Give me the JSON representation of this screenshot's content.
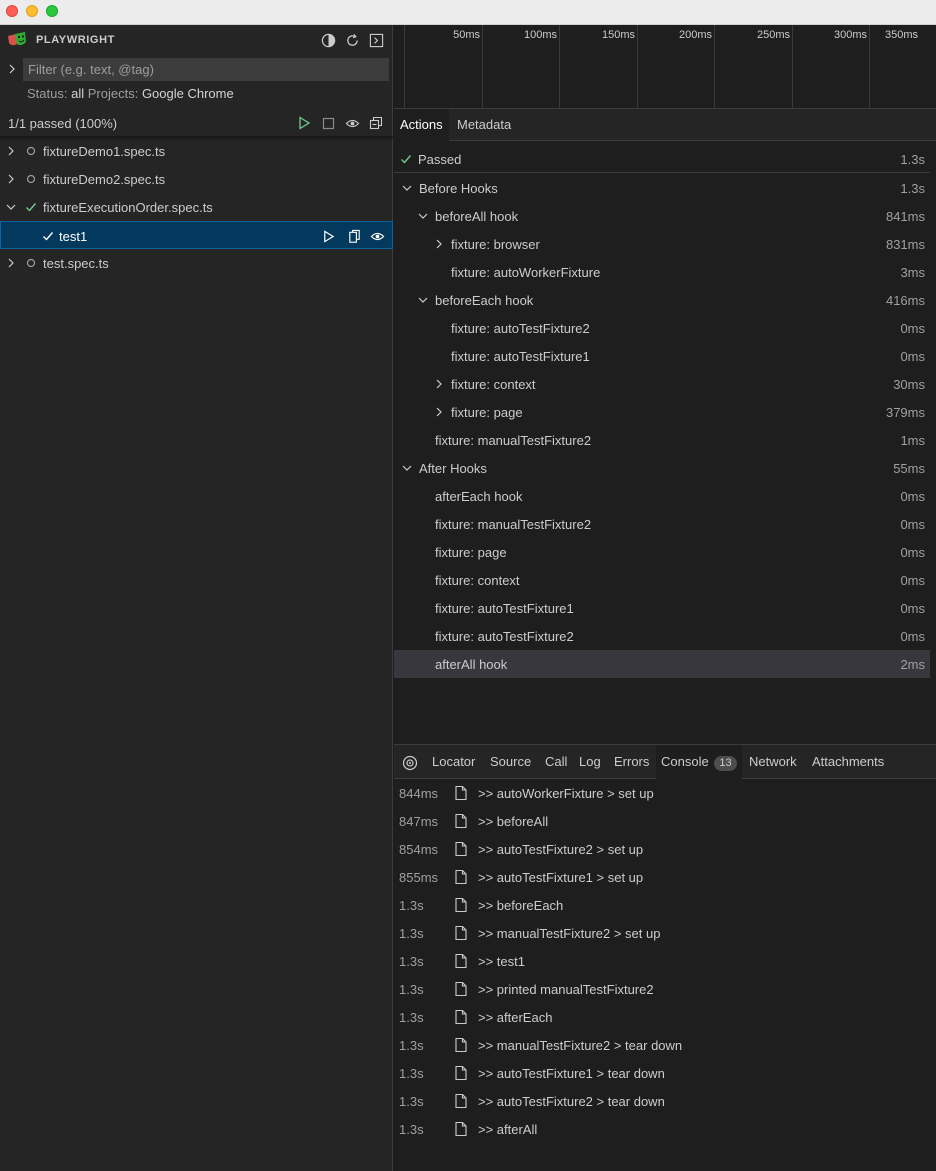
{
  "sidebar": {
    "app_title": "PLAYWRIGHT",
    "filter_placeholder": "Filter (e.g. text, @tag)",
    "status_label": "Status:",
    "status_value": "all",
    "projects_label": "Projects:",
    "projects_value": "Google Chrome",
    "summary": "1/1 passed (100%)",
    "tree": [
      {
        "label": "fixtureDemo1.spec.ts",
        "state": "idle",
        "expanded": false
      },
      {
        "label": "fixtureDemo2.spec.ts",
        "state": "idle",
        "expanded": false
      },
      {
        "label": "fixtureExecutionOrder.spec.ts",
        "state": "passed",
        "expanded": true
      },
      {
        "label": "test1",
        "state": "passed",
        "selected": true
      },
      {
        "label": "test.spec.ts",
        "state": "idle",
        "expanded": false
      }
    ]
  },
  "timeline": {
    "ticks": [
      "50ms",
      "100ms",
      "150ms",
      "200ms",
      "250ms",
      "300ms",
      "350ms"
    ]
  },
  "top_tabs": [
    "Actions",
    "Metadata"
  ],
  "actions": [
    {
      "label": "Passed",
      "time": "1.3s"
    },
    {
      "label": "Before Hooks",
      "time": "1.3s"
    },
    {
      "label": "beforeAll hook",
      "time": "841ms"
    },
    {
      "label": "fixture: browser",
      "time": "831ms"
    },
    {
      "label": "fixture: autoWorkerFixture",
      "time": "3ms"
    },
    {
      "label": "beforeEach hook",
      "time": "416ms"
    },
    {
      "label": "fixture: autoTestFixture2",
      "time": "0ms"
    },
    {
      "label": "fixture: autoTestFixture1",
      "time": "0ms"
    },
    {
      "label": "fixture: context",
      "time": "30ms"
    },
    {
      "label": "fixture: page",
      "time": "379ms"
    },
    {
      "label": "fixture: manualTestFixture2",
      "time": "1ms"
    },
    {
      "label": "After Hooks",
      "time": "55ms"
    },
    {
      "label": "afterEach hook",
      "time": "0ms"
    },
    {
      "label": "fixture: manualTestFixture2",
      "time": "0ms"
    },
    {
      "label": "fixture: page",
      "time": "0ms"
    },
    {
      "label": "fixture: context",
      "time": "0ms"
    },
    {
      "label": "fixture: autoTestFixture1",
      "time": "0ms"
    },
    {
      "label": "fixture: autoTestFixture2",
      "time": "0ms"
    },
    {
      "label": "afterAll hook",
      "time": "2ms"
    }
  ],
  "bottom_tabs": {
    "locator": "Locator",
    "source": "Source",
    "call": "Call",
    "log": "Log",
    "errors": "Errors",
    "console": "Console",
    "console_count": "13",
    "network": "Network",
    "attachments": "Attachments"
  },
  "console": [
    {
      "time": "844ms",
      "text": ">> autoWorkerFixture > set up"
    },
    {
      "time": "847ms",
      "text": ">> beforeAll"
    },
    {
      "time": "854ms",
      "text": ">> autoTestFixture2 > set up"
    },
    {
      "time": "855ms",
      "text": ">> autoTestFixture1 > set up"
    },
    {
      "time": "1.3s",
      "text": ">> beforeEach"
    },
    {
      "time": "1.3s",
      "text": ">> manualTestFixture2 > set up"
    },
    {
      "time": "1.3s",
      "text": ">> test1"
    },
    {
      "time": "1.3s",
      "text": ">> printed manualTestFixture2"
    },
    {
      "time": "1.3s",
      "text": ">> afterEach"
    },
    {
      "time": "1.3s",
      "text": ">> manualTestFixture2 > tear down"
    },
    {
      "time": "1.3s",
      "text": ">> autoTestFixture1 > tear down"
    },
    {
      "time": "1.3s",
      "text": ">> autoTestFixture2 > tear down"
    },
    {
      "time": "1.3s",
      "text": ">> afterAll"
    }
  ],
  "colors": {
    "passed": "#73c991",
    "selected_bg": "#04395e",
    "accent": "#0e639c"
  }
}
